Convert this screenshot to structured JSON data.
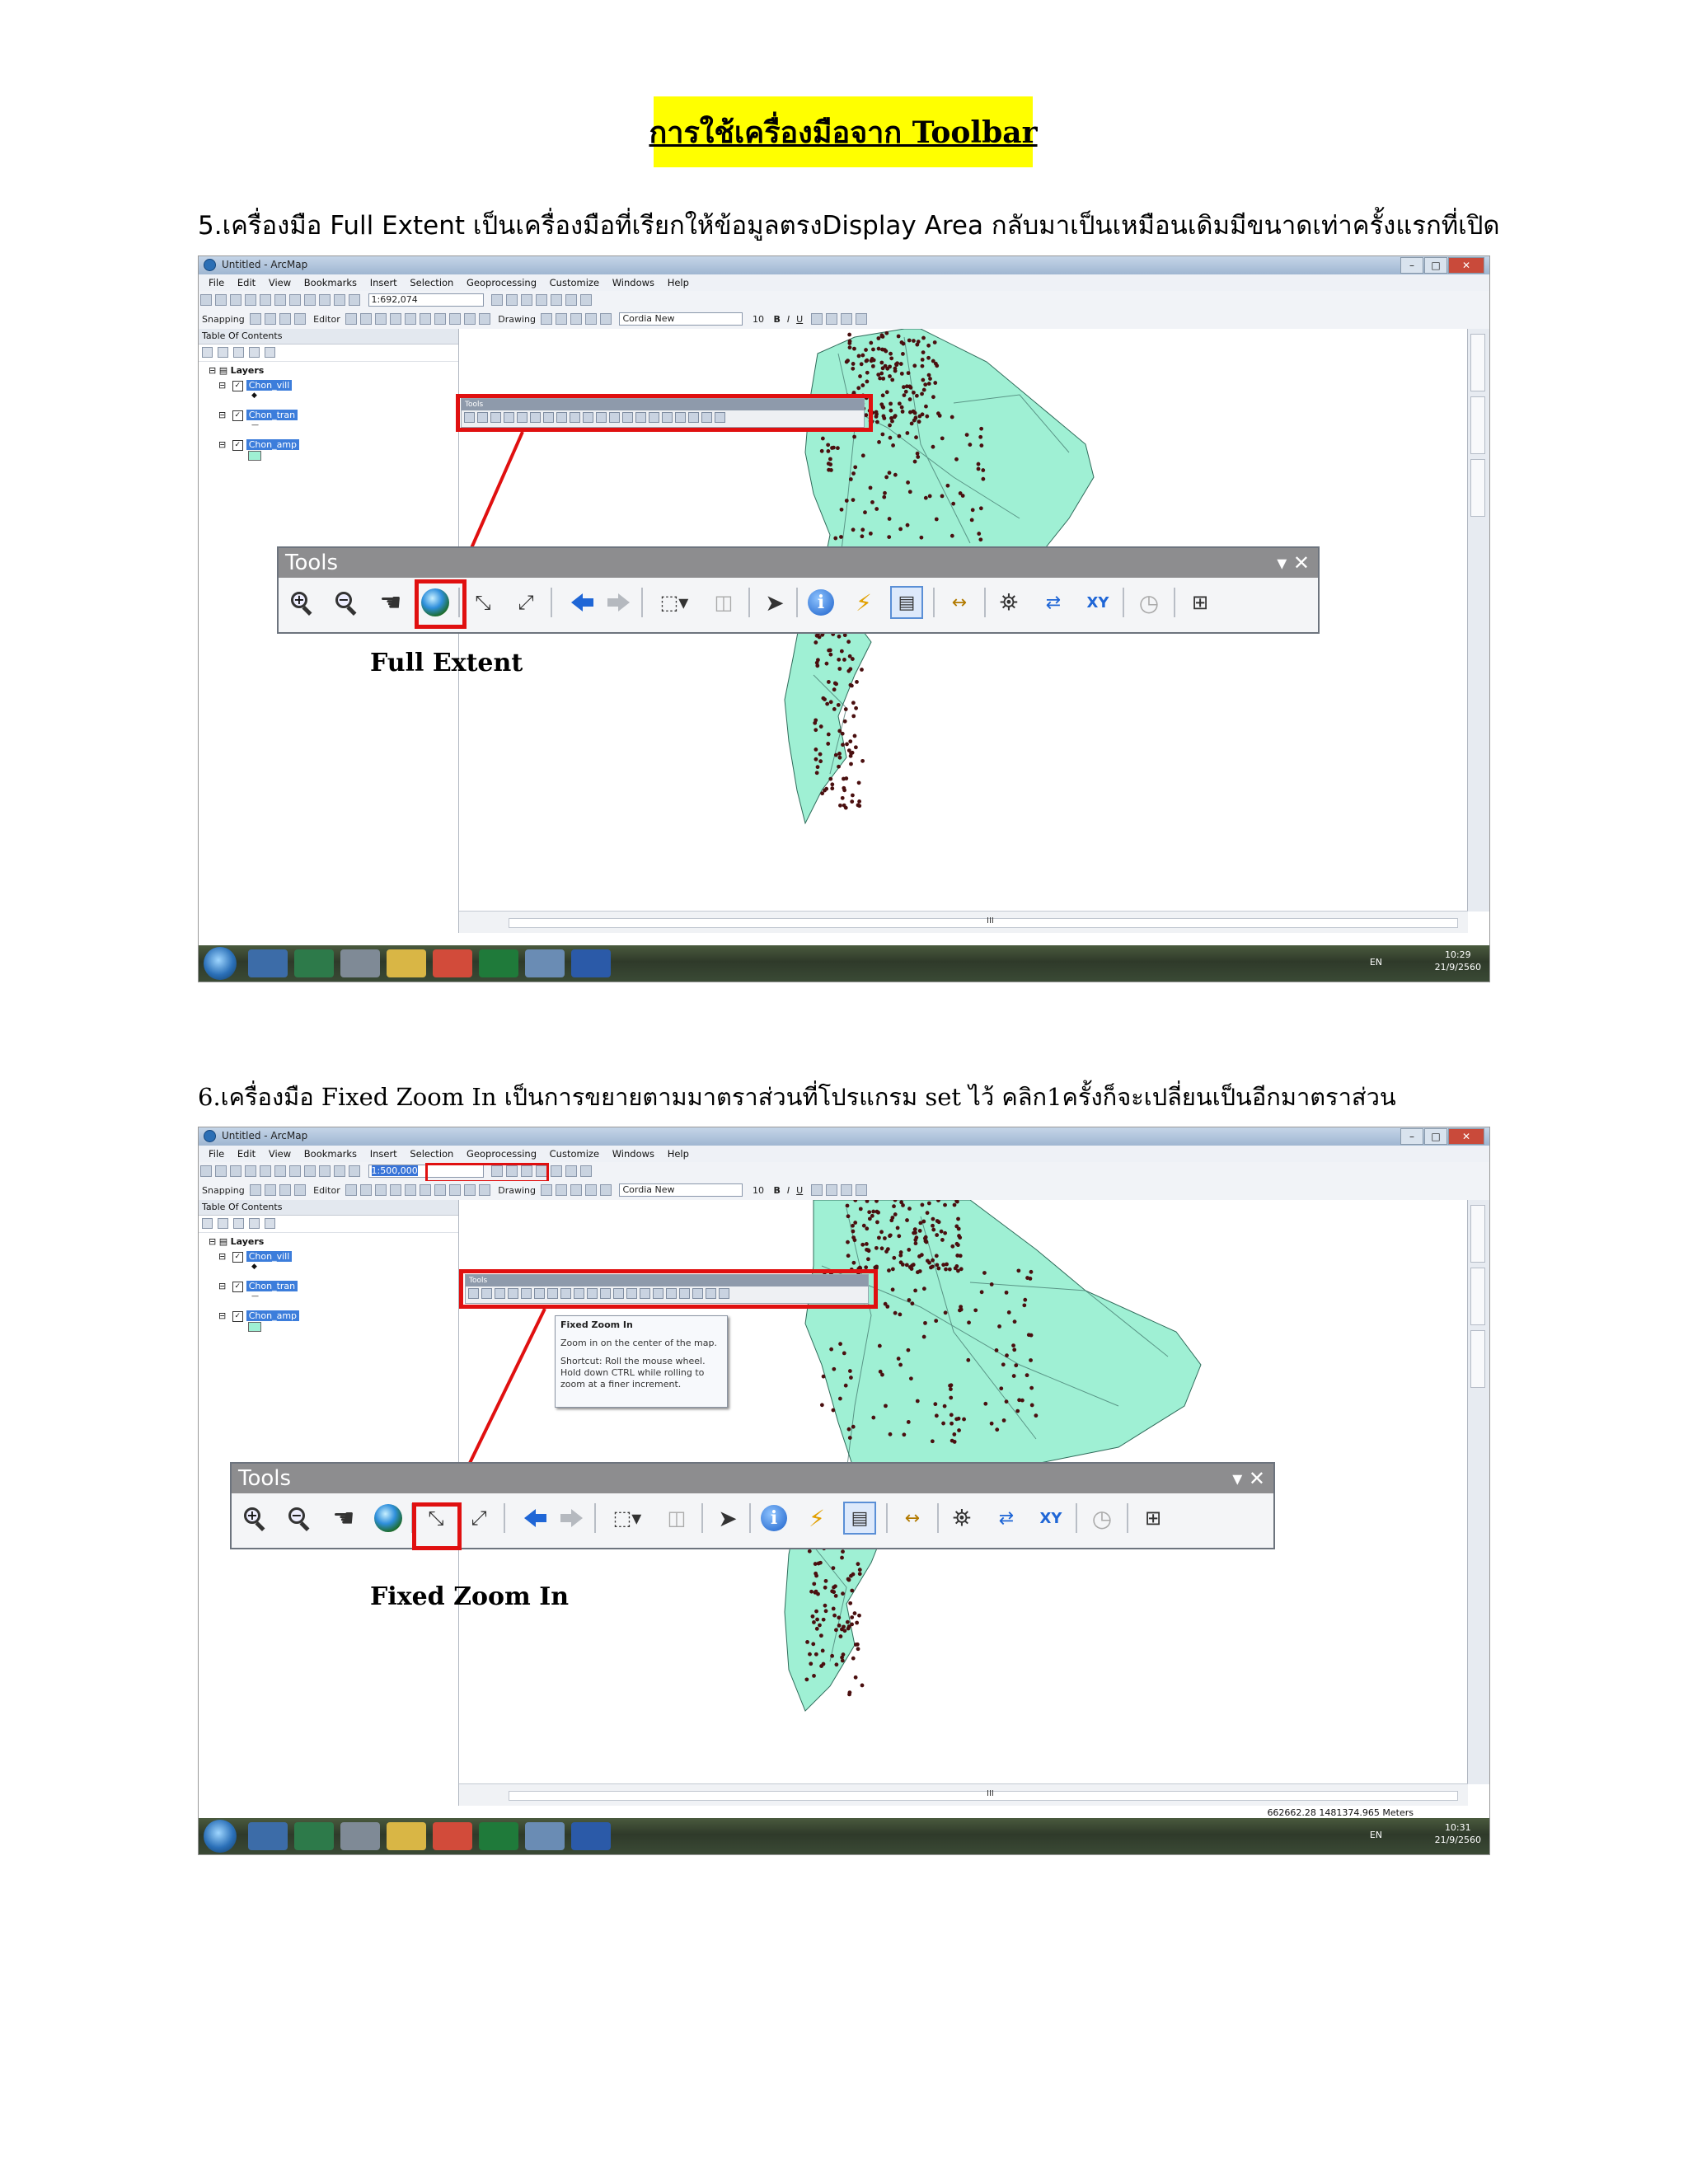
{
  "page": {
    "title": "การใช้เครื่องมือจาก Toolbar",
    "step5": "5.เครื่องมือ Full Extent เป็นเครื่องมือที่เรียกให้ข้อมูลตรงDisplay Area กลับมาเป็นเหมือนเดิมมีขนาดเท่าครั้งแรกที่เปิด",
    "step6": "6.เครื่องมือ Fixed Zoom In เป็นการขยายตามมาตราส่วนที่โปรแกรม set ไว้ คลิก1ครั้งก็จะเปลี่ยนเป็นอีกมาตราส่วน"
  },
  "arcmap": {
    "window_title": "Untitled - ArcMap",
    "menus": [
      "File",
      "Edit",
      "View",
      "Bookmarks",
      "Insert",
      "Selection",
      "Geoprocessing",
      "Customize",
      "Windows",
      "Help"
    ],
    "snapping_label": "Snapping",
    "editor_label": "Editor",
    "drawing_label": "Drawing",
    "font_name": "Cordia New",
    "font_size": "10",
    "toc_title": "Table Of Contents",
    "layers_label": "Layers",
    "layers": [
      "Chon_vill",
      "Chon_tran",
      "Chon_amp"
    ],
    "tools_mini_title": "Tools",
    "hscroll_mark": "III"
  },
  "shot1": {
    "scale_value": "1:692,074",
    "big_tools_title": "Tools",
    "caption": "Full Extent",
    "tray_lang": "EN",
    "tray_time": "10:29",
    "tray_date": "21/9/2560"
  },
  "shot2": {
    "scale_value": "1:500,000",
    "big_tools_title": "Tools",
    "caption": "Fixed Zoom In",
    "tooltip_title": "Fixed Zoom In",
    "tooltip_line1": "Zoom in on the center of the map.",
    "tooltip_line2": "Shortcut: Roll the mouse wheel. Hold down CTRL while rolling to zoom at a finer increment.",
    "coords": "662662.28  1481374.965 Meters",
    "tray_lang": "EN",
    "tray_time": "10:31",
    "tray_date": "21/9/2560"
  },
  "colors": {
    "title_highlight": "#ffff00",
    "callout_red": "#e01010",
    "land_fill": "#9ff0d4",
    "point_color": "#5a1010"
  }
}
